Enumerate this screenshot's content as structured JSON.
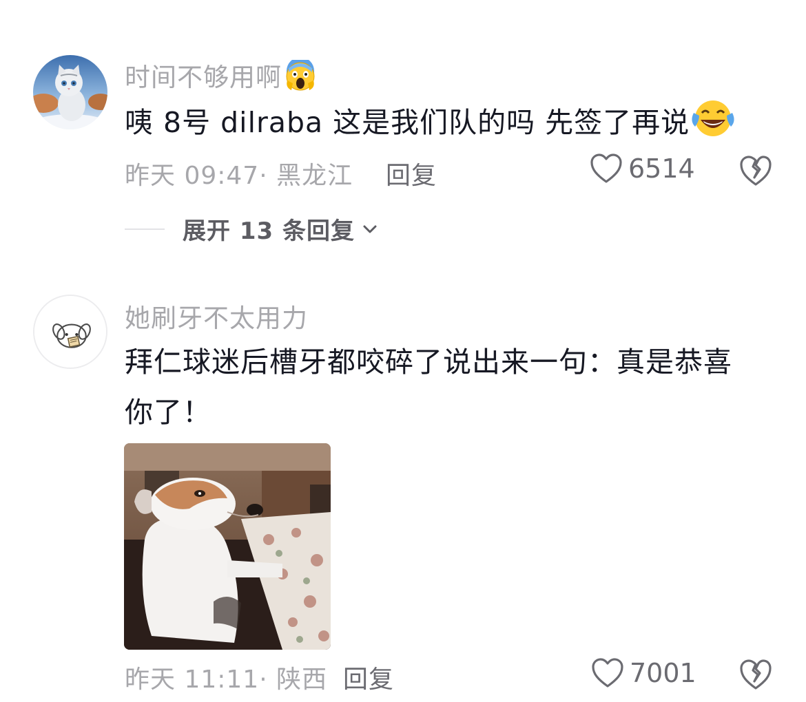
{
  "comments": [
    {
      "username": "时间不够用啊",
      "text": "咦 8号  dilraba  这是我们队的吗  先签了再说",
      "time_location": "昨天 09:47· 黑龙江",
      "reply_label": "回复",
      "likes": "6514",
      "expand_label": "展开 13 条回复",
      "username_emoji": "screaming-face-emoji",
      "text_emoji": "tears-of-joy-emoji"
    },
    {
      "username": "她刷牙不太用力",
      "text_line1": "拜仁球迷后槽牙都咬碎了说出来一句：真是恭喜",
      "text_line2": "你了！",
      "time_location": "昨天 11:11· 陕西",
      "reply_label": "回复",
      "likes": "7001"
    }
  ],
  "colors": {
    "primary_text": "#161823",
    "secondary_text": "#a7a7ab",
    "action_text": "#6b6b71"
  }
}
